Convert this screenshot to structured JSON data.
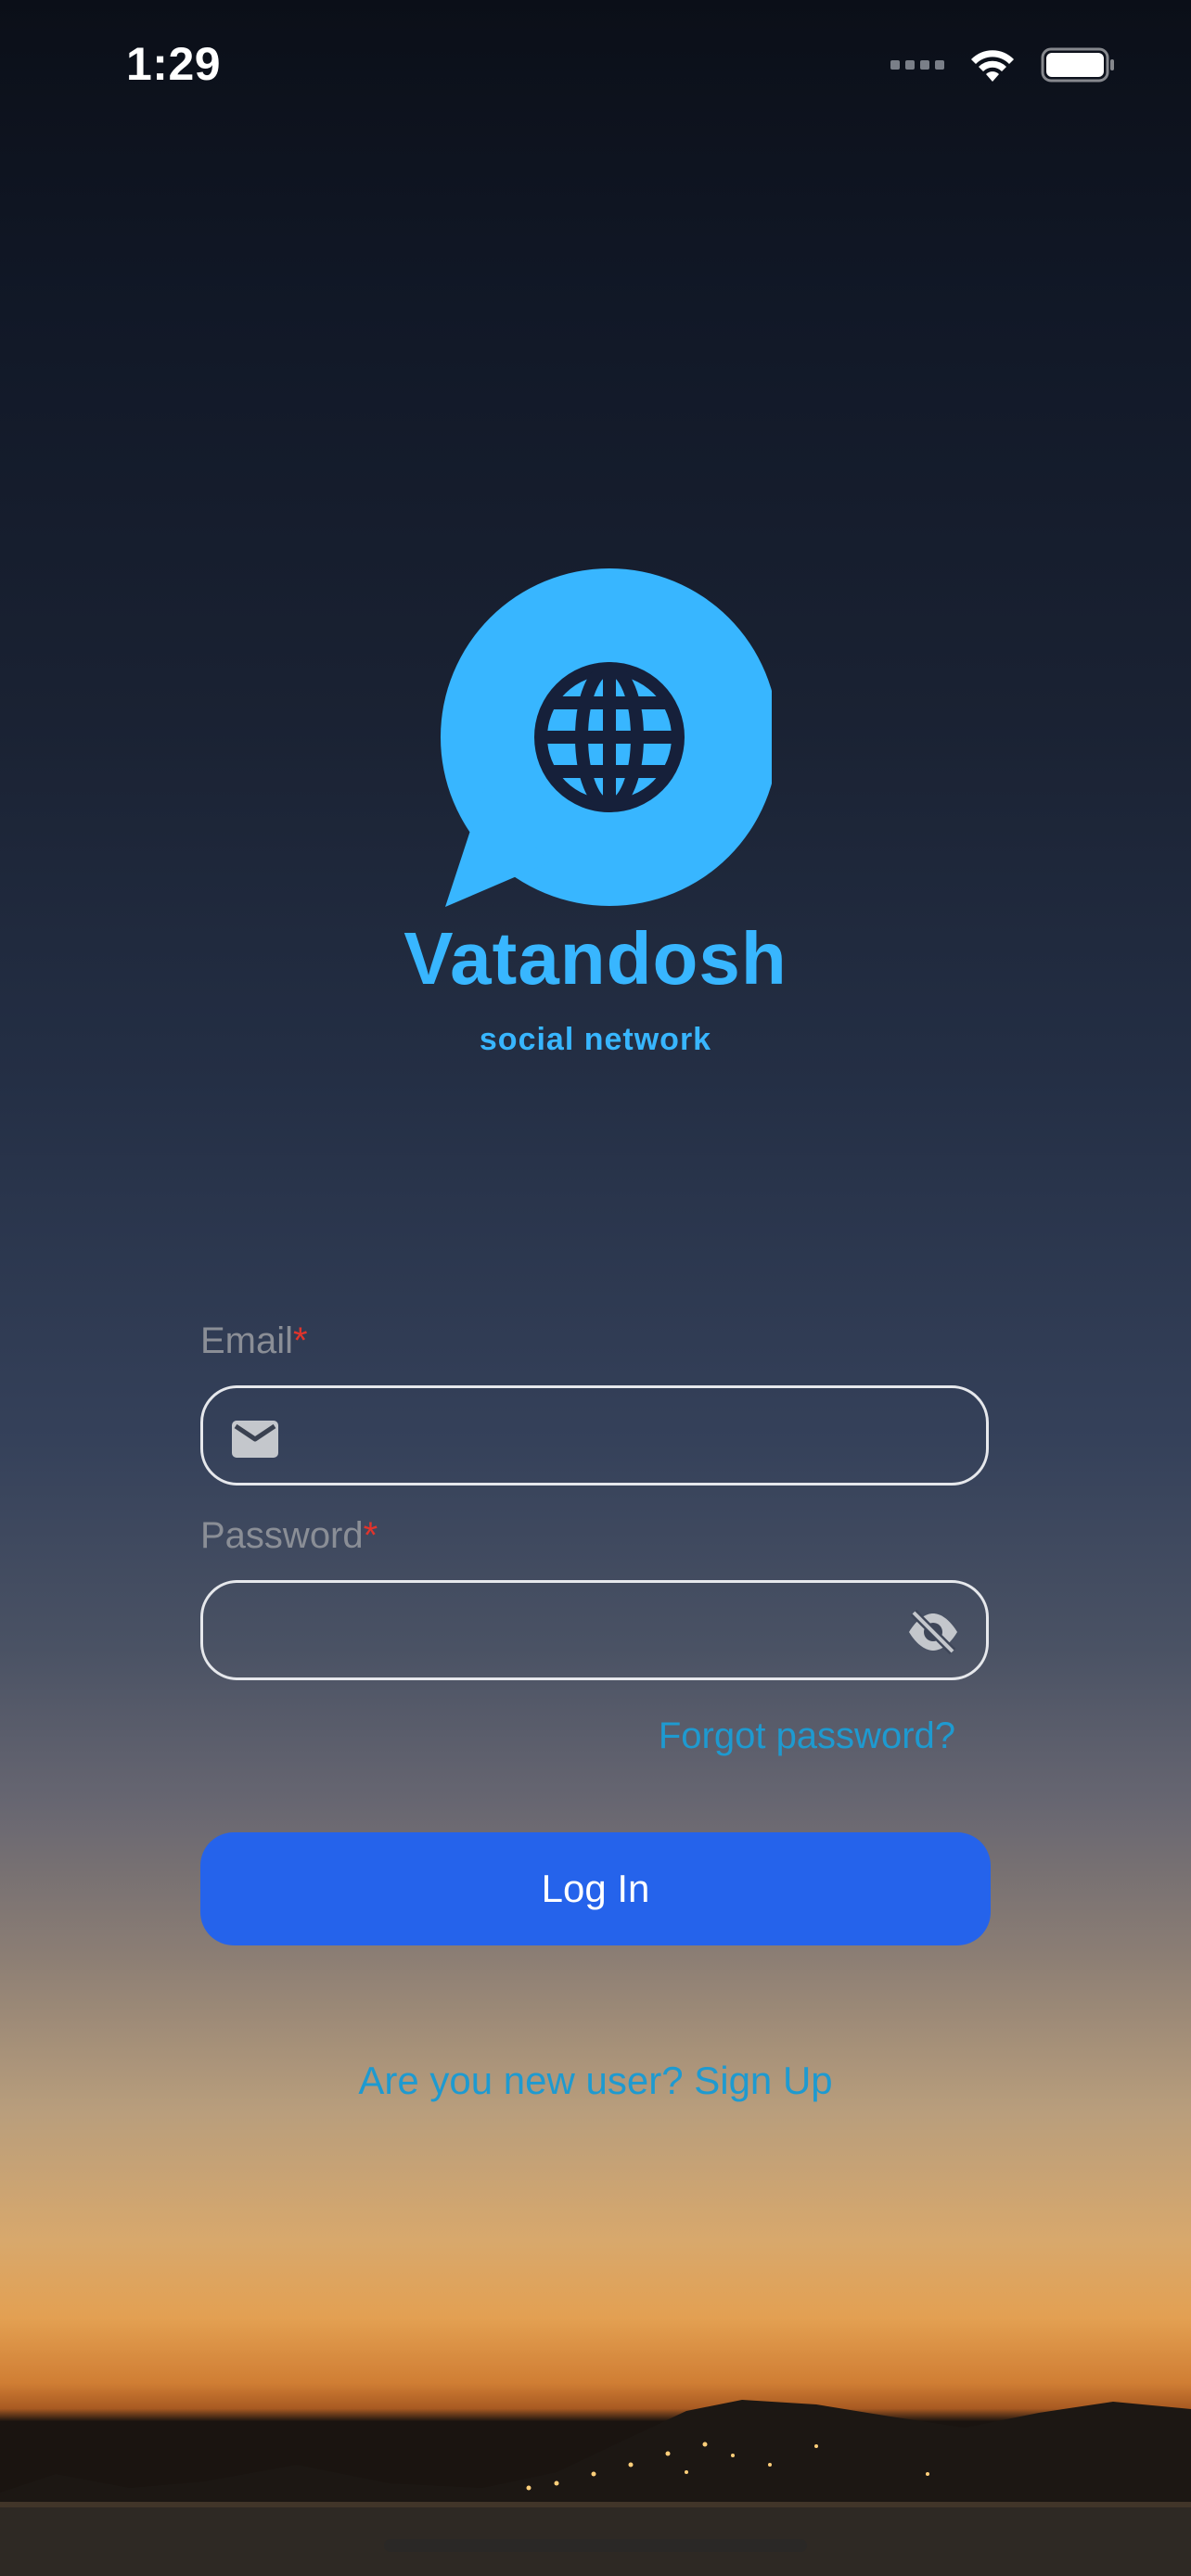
{
  "status_bar": {
    "time": "1:29",
    "icons": [
      "signal-dots-icon",
      "wifi-icon",
      "battery-icon"
    ]
  },
  "branding": {
    "logo_icon": "globe-chat-bubble-icon",
    "name": "Vatandosh",
    "tagline": "social network",
    "accent_color": "#38b6ff"
  },
  "form": {
    "email": {
      "label": "Email",
      "required_mark": "*",
      "value": "",
      "icon": "envelope-icon"
    },
    "password": {
      "label": "Password",
      "required_mark": "*",
      "value": "",
      "icon": "eye-slash-icon"
    },
    "forgot_password": "Forgot password?",
    "login_button": "Log In",
    "signup_prompt": "Are you new user? Sign Up"
  },
  "colors": {
    "primary_button": "#2563eb",
    "link": "#1e9ad0",
    "required": "#e0342c"
  }
}
